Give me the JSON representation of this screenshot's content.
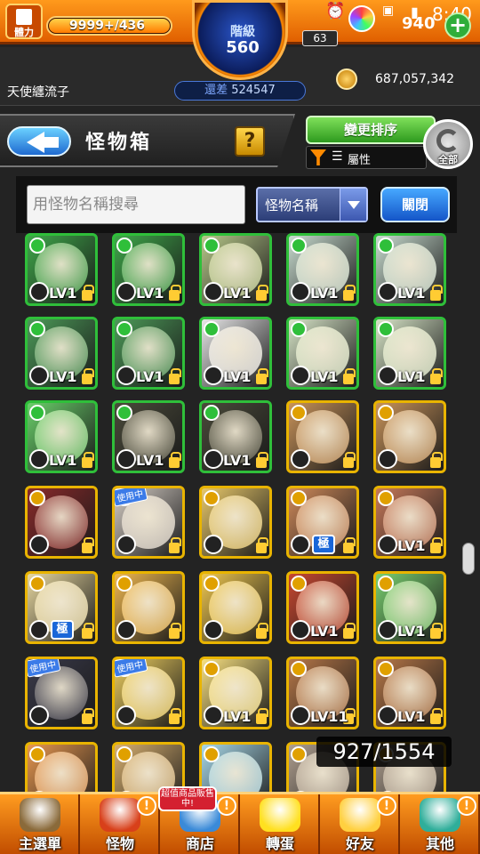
{
  "header": {
    "stamina_label": "體力",
    "stamina_value": "9999+",
    "stamina_max": "/436",
    "stamina_fill": 1.0,
    "rank_label": "階級",
    "rank_value": "560",
    "friend_count": "63",
    "gem_count": "940",
    "time": "8:40",
    "plus_label": "+"
  },
  "player": {
    "name": "天使纏流子",
    "exp_label": "還差",
    "exp_remaining": "524547",
    "gold": "687,057,342"
  },
  "title_bar": {
    "title": "怪物箱",
    "help_label": "?",
    "sort_label": "變更排序",
    "filter_label": "屬性",
    "all_label": "全部"
  },
  "search": {
    "placeholder": "用怪物名稱搜尋",
    "dropdown_value": "怪物名稱",
    "close_label": "關閉"
  },
  "grid": {
    "count_text": "927/1554",
    "cards": [
      {
        "frame": "green",
        "lvl": "LV1",
        "color": "#3fa84a"
      },
      {
        "frame": "green",
        "lvl": "LV1",
        "color": "#3fa84a"
      },
      {
        "frame": "green",
        "lvl": "LV1",
        "color": "#b8c98a"
      },
      {
        "frame": "green",
        "lvl": "LV1",
        "color": "#c9ddd0"
      },
      {
        "frame": "green",
        "lvl": "LV1",
        "color": "#c9ddd0"
      },
      {
        "frame": "green",
        "lvl": "LV1",
        "color": "#4c9a58"
      },
      {
        "frame": "green",
        "lvl": "LV1",
        "color": "#4c9a58"
      },
      {
        "frame": "green",
        "lvl": "LV1",
        "color": "#e8e8e8"
      },
      {
        "frame": "green",
        "lvl": "LV1",
        "color": "#d8e6c8"
      },
      {
        "frame": "green",
        "lvl": "LV1",
        "color": "#d8e6c8"
      },
      {
        "frame": "green",
        "lvl": "LV1",
        "color": "#6ad06a"
      },
      {
        "frame": "green",
        "lvl": "LV1",
        "color": "#4a4a3a"
      },
      {
        "frame": "green",
        "lvl": "LV1",
        "color": "#4a4a3a"
      },
      {
        "frame": "gold",
        "lvl": "",
        "color": "#c8935a"
      },
      {
        "frame": "gold",
        "lvl": "",
        "color": "#c8935a"
      },
      {
        "frame": "gold",
        "lvl": "",
        "color": "#8a2a2a"
      },
      {
        "frame": "gold",
        "lvl": "",
        "color": "#d8d0c8",
        "inuse": "使用中"
      },
      {
        "frame": "gold",
        "lvl": "",
        "color": "#e8c86a"
      },
      {
        "frame": "gold",
        "lvl": "",
        "color": "#d08a5a",
        "extreme": "極"
      },
      {
        "frame": "gold",
        "lvl": "LV1",
        "color": "#c87a5a"
      },
      {
        "frame": "gold",
        "lvl": "",
        "color": "#e8d8a0",
        "extreme": "極"
      },
      {
        "frame": "gold",
        "lvl": "",
        "color": "#f0b850"
      },
      {
        "frame": "gold",
        "lvl": "",
        "color": "#f0c850"
      },
      {
        "frame": "gold",
        "lvl": "LV1",
        "color": "#c84830"
      },
      {
        "frame": "gold",
        "lvl": "LV1",
        "color": "#7ad070"
      },
      {
        "frame": "gold",
        "lvl": "",
        "color": "#3a3a4a",
        "inuse": "使用中"
      },
      {
        "frame": "gold",
        "lvl": "",
        "color": "#f0d060",
        "inuse": "使用中"
      },
      {
        "frame": "gold",
        "lvl": "LV1",
        "color": "#f8e080"
      },
      {
        "frame": "gold",
        "lvl": "LV11",
        "color": "#b87848"
      },
      {
        "frame": "gold",
        "lvl": "LV1",
        "color": "#b87848"
      },
      {
        "frame": "gold",
        "lvl": "",
        "color": "#e89850"
      },
      {
        "frame": "gold",
        "lvl": "",
        "color": "#d8b070"
      },
      {
        "frame": "gold",
        "lvl": "",
        "color": "#a8d8e8"
      },
      {
        "frame": "gold",
        "lvl": "",
        "color": "#b0a090"
      },
      {
        "frame": "gold",
        "lvl": "",
        "color": "#b0a090"
      }
    ]
  },
  "nav": {
    "promo_text": "超值商品販售中!",
    "items": [
      {
        "label": "主選單",
        "icon": "house-icon",
        "color": "#8a6a3a",
        "alert": ""
      },
      {
        "label": "怪物",
        "icon": "monster-icon",
        "color": "#d8401a",
        "alert": "!"
      },
      {
        "label": "商店",
        "icon": "shop-icon",
        "color": "#3a8ad8",
        "alert": "!"
      },
      {
        "label": "轉蛋",
        "icon": "egg-icon",
        "color": "#ffe020",
        "alert": ""
      },
      {
        "label": "好友",
        "icon": "friends-icon",
        "color": "#ffd040",
        "alert": "!"
      },
      {
        "label": "其他",
        "icon": "other-icon",
        "color": "#2fae9a",
        "alert": "!"
      }
    ]
  }
}
